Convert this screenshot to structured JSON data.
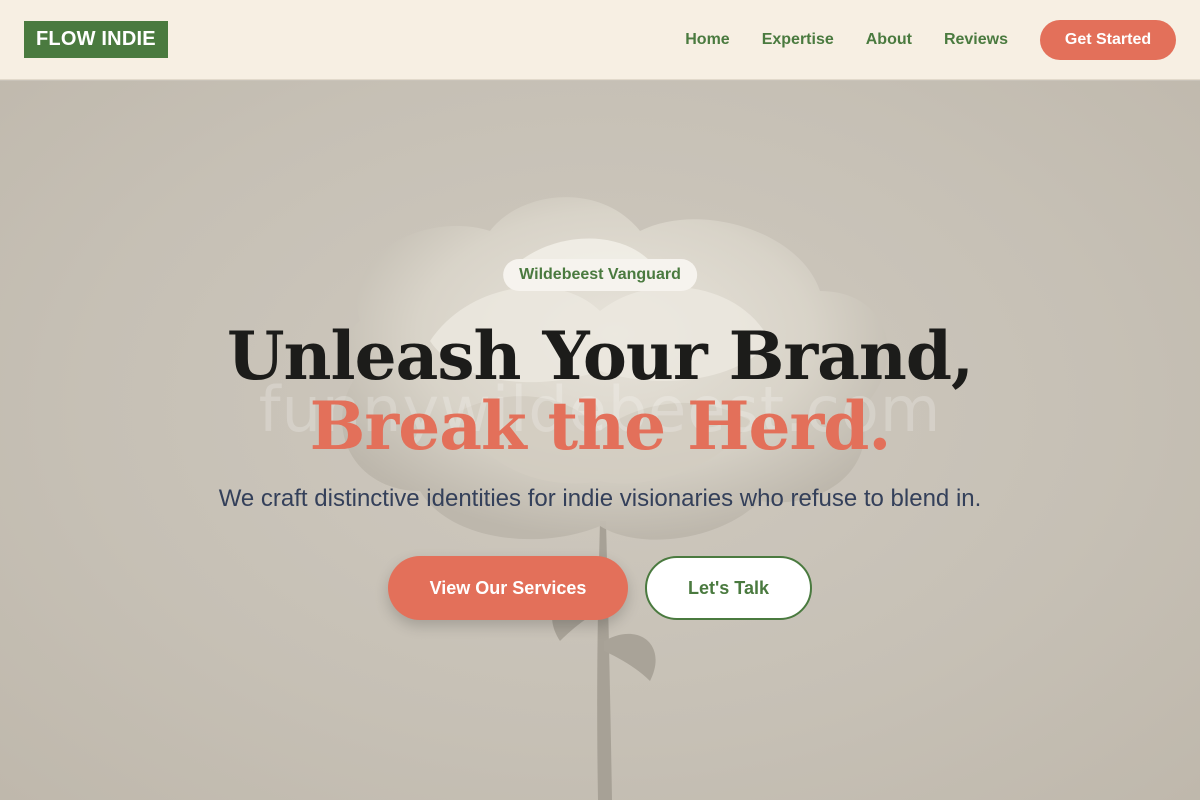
{
  "brand": {
    "logo_text": "FLOW INDIE"
  },
  "nav": {
    "links": [
      "Home",
      "Expertise",
      "About",
      "Reviews"
    ],
    "cta_label": "Get Started"
  },
  "hero": {
    "badge": "Wildebeest Vanguard",
    "headline_line1": "Unleash Your Brand,",
    "headline_line2": "Break the Herd.",
    "subtitle": "We craft distinctive identities for indie visionaries who refuse to blend in.",
    "primary_button": "View Our Services",
    "secondary_button": "Let's Talk",
    "watermark": "funnywildebeest.com",
    "background_image": "rose-photo"
  },
  "colors": {
    "brand_green": "#4a7a3f",
    "accent_coral": "#e3705a",
    "nav_bg": "#f7efe3",
    "headline_dark": "#1c1c1a",
    "subtitle_navy": "#34405a"
  }
}
